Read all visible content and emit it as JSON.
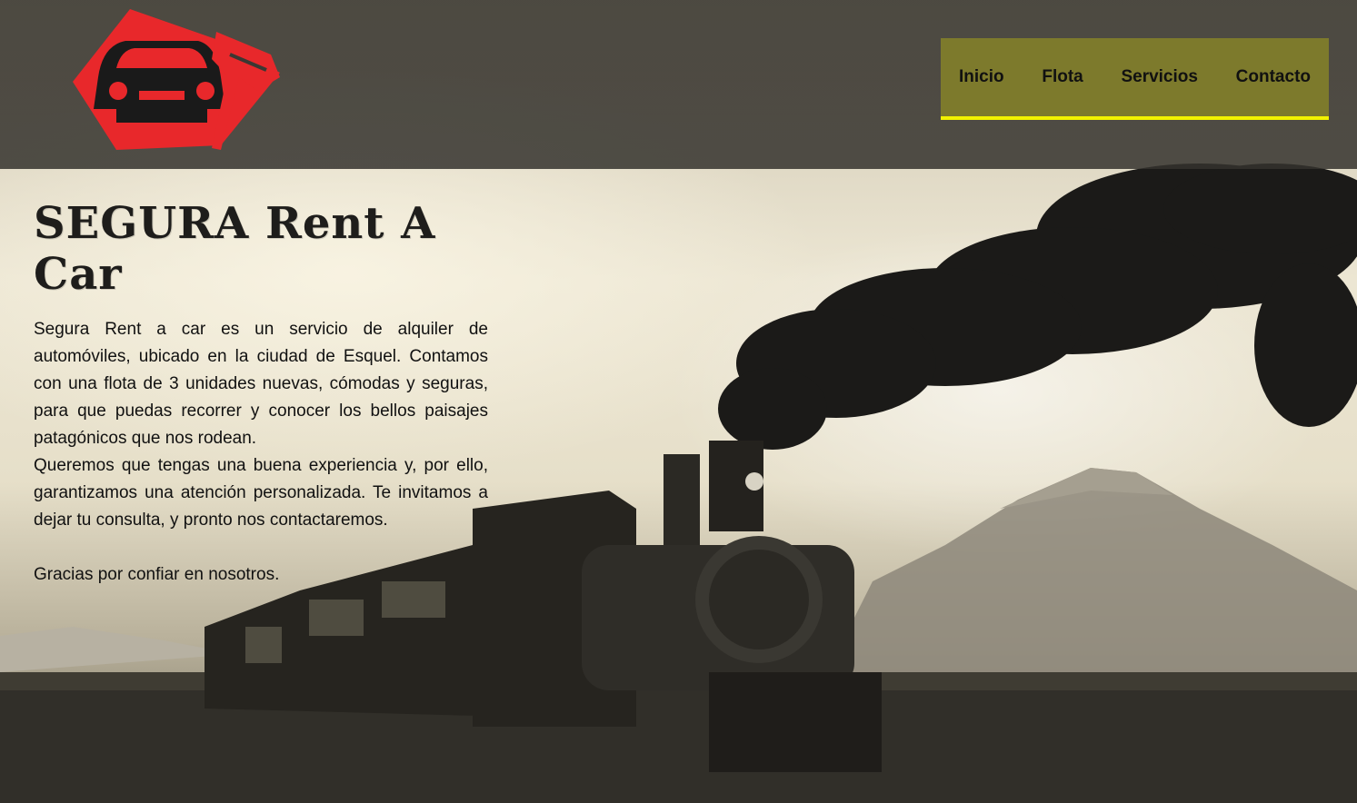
{
  "brand": {
    "logo_icon": "car-key-icon",
    "logo_color": "#e8282b"
  },
  "nav": {
    "items": [
      "Inicio",
      "Flota",
      "Servicios",
      "Contacto"
    ],
    "background": "#7d7a2c",
    "underline_color": "#f2f200"
  },
  "main": {
    "title": "SEGURA Rent A Car",
    "paragraph_1": "Segura Rent a car es un servicio de alquiler de automóviles, ubicado en la ciudad de Esquel. Contamos con una flota de 3 unidades nuevas, cómodas y seguras, para que puedas recorrer y conocer los bellos paisajes patagónicos que nos rodean.",
    "paragraph_2": "Queremos que tengas una buena experiencia y, por ello, garantizamos una atención personalizada. Te invitamos a dejar tu consulta, y pronto nos contactaremos.",
    "paragraph_3": "Gracias por confiar en nosotros."
  },
  "background_image": {
    "icon": "steam-train-photo"
  }
}
